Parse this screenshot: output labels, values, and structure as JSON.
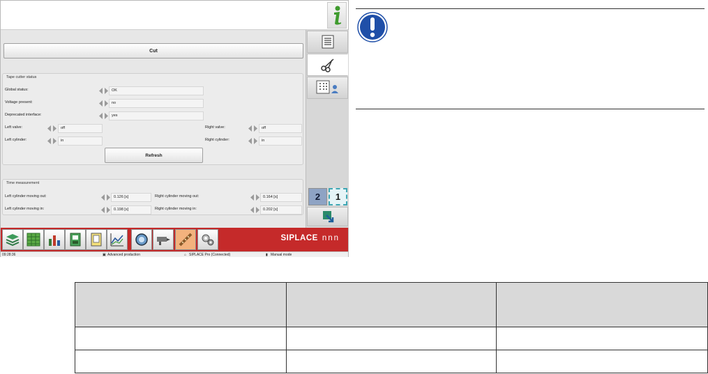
{
  "window": {
    "cut_label": "Cut",
    "tape_cutter": {
      "title": "Tape cutter status",
      "global_status_label": "Global status:",
      "global_status_value": "OK",
      "voltage_label": "Voltage present:",
      "voltage_value": "no",
      "deprecated_label": "Deprecated interface:",
      "deprecated_value": "yes",
      "left_valve_label": "Left valve:",
      "left_valve_value": "off",
      "right_valve_label": "Right valve:",
      "right_valve_value": "off",
      "left_cylinder_label": "Left cylinder:",
      "left_cylinder_value": "in",
      "right_cylinder_label": "Right cylinder:",
      "right_cylinder_value": "in",
      "refresh_label": "Refresh"
    },
    "time_measurement": {
      "title": "Time measurement",
      "left_out_label": "Left cylinder moving out:",
      "left_out_value": "0.126 [s]",
      "right_out_label": "Right cylinder moving out:",
      "right_out_value": "0.164 [s]",
      "left_in_label": "Left cylinder moving in:",
      "left_in_value": "0.198 [s]",
      "right_in_label": "Right cylinder moving in:",
      "right_in_value": "0.202 [s]"
    },
    "right_nav": {
      "tabs": [
        "list-icon",
        "scissors-icon",
        "grid-user-icon"
      ],
      "pager_2": "2",
      "pager_1": "1"
    },
    "toolbar": {
      "icons": [
        "stack-icon",
        "spreadsheet-icon",
        "bar-chart-icon",
        "feeder-icon",
        "document-icon",
        "trend-chart-icon",
        "camera-icon",
        "nozzle-icon",
        "cutter-icon",
        "settings-gears-icon"
      ],
      "brand": "SIPLACE",
      "brand_mark": "nnn",
      "brand_color": "#c52a2a"
    },
    "status_bar": {
      "time": "09:28:36",
      "mode": "Advanced production",
      "connection": "SIPLACE Pro (Connected)",
      "operation": "Manual mode"
    }
  },
  "note": {
    "icon": "exclamation-icon",
    "icon_color": "#1f4fa8"
  },
  "table": {
    "headers": [
      "",
      "",
      ""
    ],
    "rows": [
      [
        "",
        "",
        ""
      ],
      [
        "",
        "",
        ""
      ]
    ]
  }
}
